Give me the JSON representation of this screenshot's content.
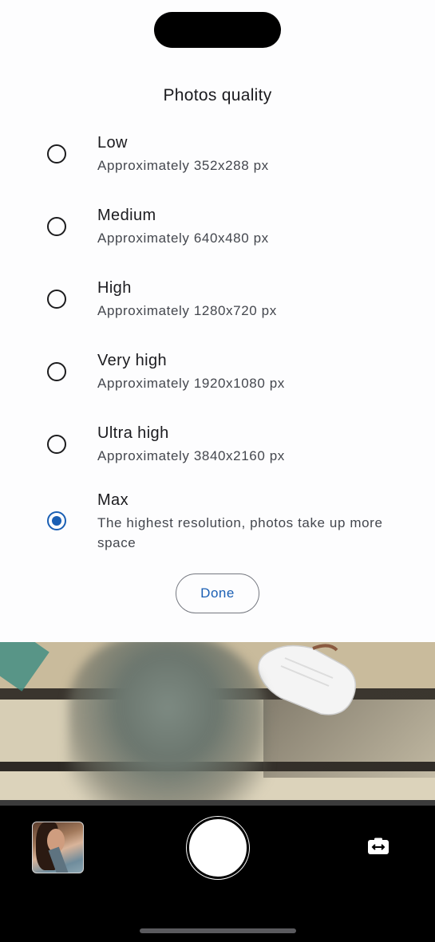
{
  "sheet": {
    "title": "Photos quality",
    "options": [
      {
        "label": "Low",
        "description": "Approximately 352x288 px",
        "selected": false
      },
      {
        "label": "Medium",
        "description": "Approximately 640x480 px",
        "selected": false
      },
      {
        "label": "High",
        "description": "Approximately 1280x720 px",
        "selected": false
      },
      {
        "label": "Very high",
        "description": "Approximately 1920x1080 px",
        "selected": false
      },
      {
        "label": "Ultra high",
        "description": "Approximately 3840x2160 px",
        "selected": false
      },
      {
        "label": "Max",
        "description": "The highest resolution, photos take up more space",
        "selected": true
      }
    ],
    "done_label": "Done"
  },
  "camera": {
    "last_photo_thumbnail": "gallery-thumbnail",
    "shutter_icon": "shutter-button",
    "flip_icon": "switch-camera-icon"
  },
  "colors": {
    "accent": "#1a5fb4",
    "sheet_background": "#fdfdfe",
    "controls_background": "#000000"
  }
}
